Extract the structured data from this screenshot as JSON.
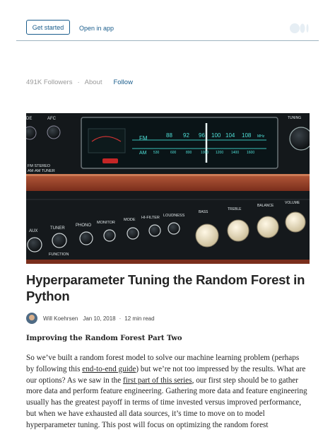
{
  "header": {
    "get_started": "Get started",
    "open_in_app": "Open in app"
  },
  "publication": {
    "followers": "491K Followers",
    "separator": "·",
    "about": "About",
    "follow": "Follow"
  },
  "article": {
    "title": "Hyperparameter Tuning the Random Forest in Python",
    "author": "Will Koehrsen",
    "date": "Jan 10, 2018",
    "dot": "·",
    "read_time": "12 min read",
    "subtitle": "Improving the Random Forest Part Two",
    "p1": "So we’ve built a random forest model to solve our machine learning problem (perhaps by following this ",
    "link1": "end-to-end guide",
    "p2": ") but we’re not too impressed by the results. What are our options? As we saw in the ",
    "link2": "first part of this series",
    "p3": ", our first step should be to gather more data and perform feature engineering. Gathering more data and feature engineering usually has the greatest payoff in terms of time invested versus improved performance, but when we have exhausted all data sources, it’s time to move on to model hyperparameter tuning. This post will focus on optimizing the random forest"
  },
  "hero_image": {
    "label_de": "DE",
    "label_afc": "AFC",
    "label_tuning": "TUNING",
    "label_fm": "FM",
    "label_am": "AM",
    "label_stereo1": "FM STEREO",
    "label_stereo2": "AM·AM TUNER",
    "label_aux": "AUX",
    "label_tuner": "TUNER",
    "label_phono": "PHONO",
    "label_monitor": "MONITOR",
    "label_mode": "MODE",
    "label_hifilter": "HI-FILTER",
    "label_loudness": "LOUDNESS",
    "label_bass": "BASS",
    "label_treble": "TREBLE",
    "label_balance": "BALANCE",
    "label_volume": "VOLUME",
    "label_function": "FUNCTION",
    "fm_scale": [
      "88",
      "92",
      "96",
      "100",
      "104",
      "108",
      "MHz"
    ],
    "am_scale": [
      "530",
      "600",
      "800",
      "1000",
      "1200",
      "1400",
      "1600"
    ]
  },
  "colors": {
    "accent": "#1a5d8c",
    "title": "#242424",
    "muted": "#9a9a9a",
    "dial_cyan": "#4fe0d8"
  }
}
